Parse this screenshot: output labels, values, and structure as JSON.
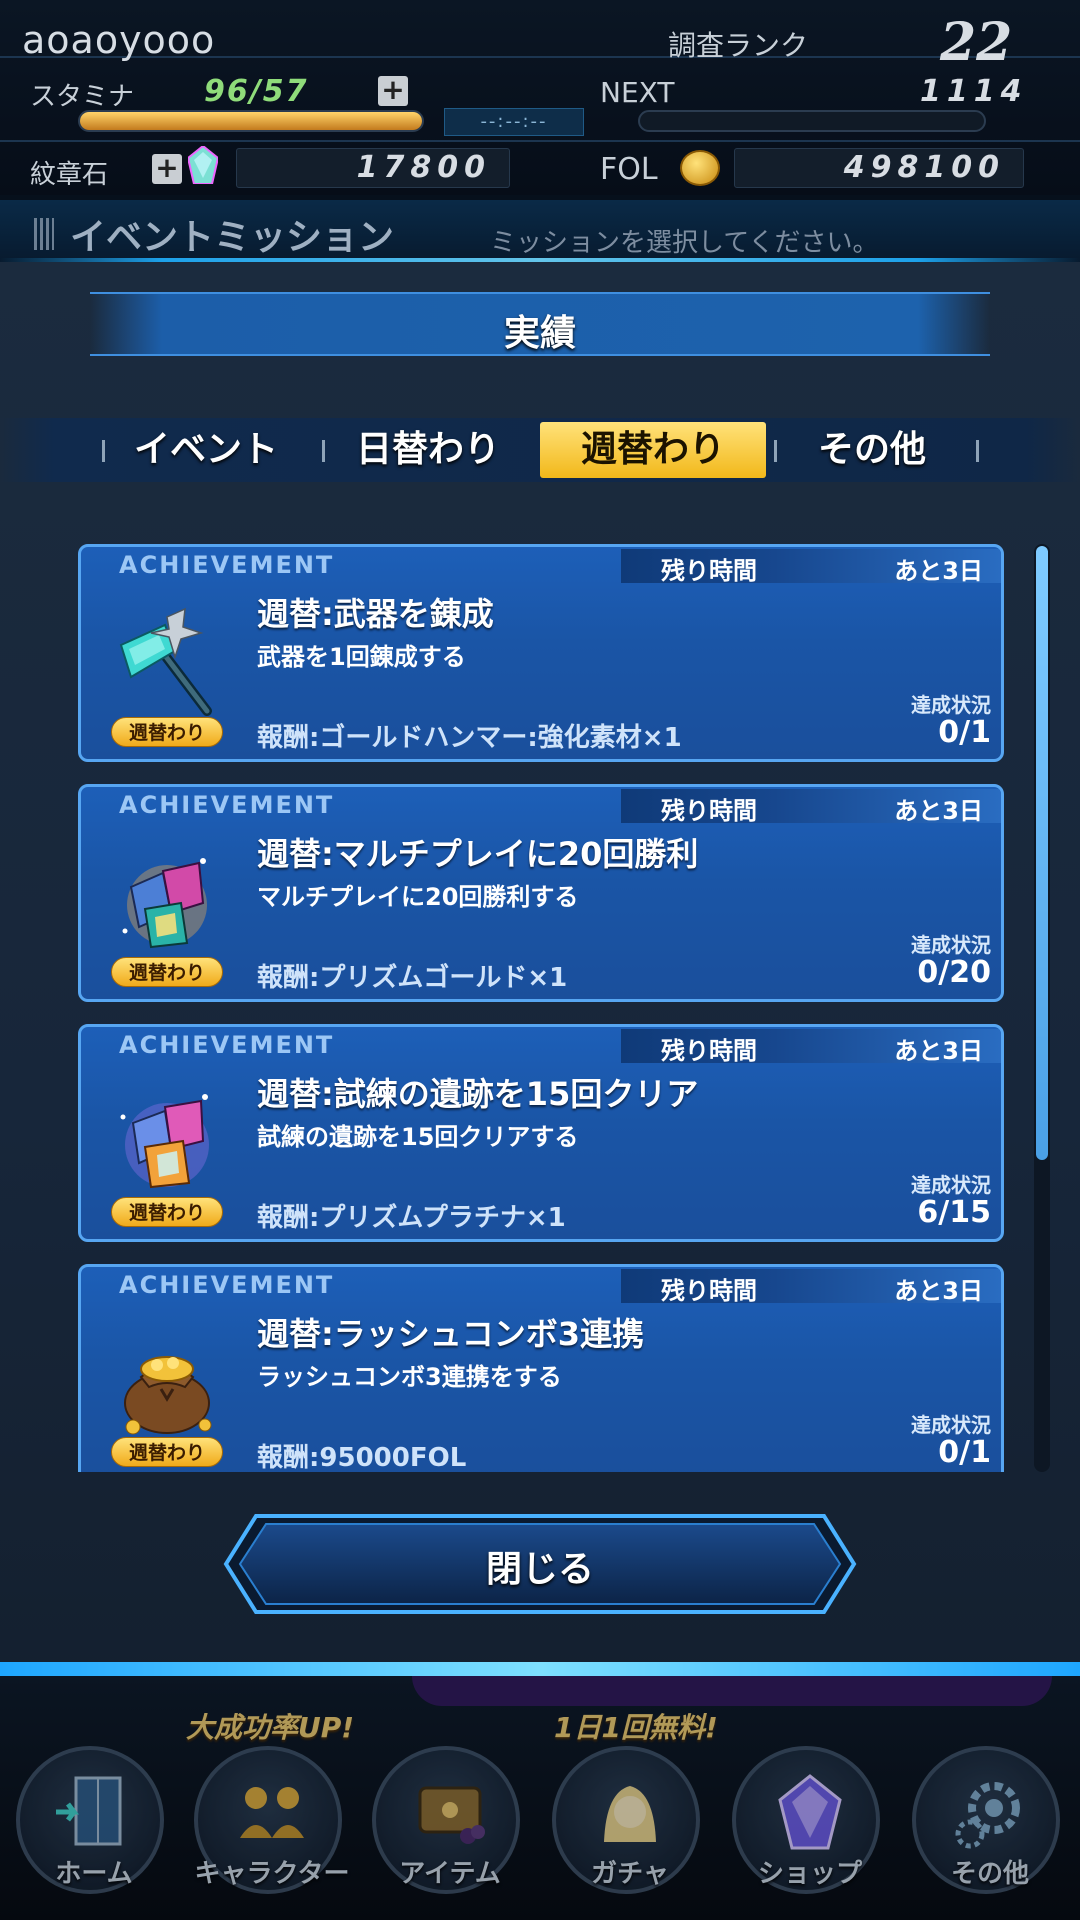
{
  "status": {
    "username": "aoaoyooo",
    "rank_label": "調査ランク",
    "rank_value": "22",
    "stamina_label": "スタミナ",
    "stamina_value": "96/57",
    "timer": "--:--:--",
    "next_label": "NEXT",
    "next_value": "1114",
    "crest_label": "紋章石",
    "crest_value": "17800",
    "fol_label": "FOL",
    "fol_value": "498100",
    "colors": {
      "stamina_text": "#8fdc7a",
      "stamina_bar": "#e9a63a"
    }
  },
  "band": {
    "title": "イベントミッション",
    "hint": "ミッションを選択してください。"
  },
  "modal": {
    "heading": "実績",
    "tabs": [
      {
        "label": "イベント",
        "active": false
      },
      {
        "label": "日替わり",
        "active": false
      },
      {
        "label": "週替わり",
        "active": true
      },
      {
        "label": "その他",
        "active": false
      }
    ],
    "cards": [
      {
        "tag": "ACHIEVEMENT",
        "time_label": "残り時間",
        "time_value": "あと3日",
        "title": "週替:武器を錬成",
        "desc": "武器を1回錬成する",
        "reward": "報酬:ゴールドハンマー:強化素材×1",
        "progress_label": "達成状況",
        "progress": "0/1",
        "badge": "週替わり",
        "icon": "hammer-icon"
      },
      {
        "tag": "ACHIEVEMENT",
        "time_label": "残り時間",
        "time_value": "あと3日",
        "title": "週替:マルチプレイに20回勝利",
        "desc": "マルチプレイに20回勝利する",
        "reward": "報酬:プリズムゴールド×1",
        "progress_label": "達成状況",
        "progress": "0/20",
        "badge": "週替わり",
        "icon": "prism-gold-icon"
      },
      {
        "tag": "ACHIEVEMENT",
        "time_label": "残り時間",
        "time_value": "あと3日",
        "title": "週替:試練の遺跡を15回クリア",
        "desc": "試練の遺跡を15回クリアする",
        "reward": "報酬:プリズムプラチナ×1",
        "progress_label": "達成状況",
        "progress": "6/15",
        "badge": "週替わり",
        "icon": "prism-platinum-icon"
      },
      {
        "tag": "ACHIEVEMENT",
        "time_label": "残り時間",
        "time_value": "あと3日",
        "title": "週替:ラッシュコンボ3連携",
        "desc": "ラッシュコンボ3連携をする",
        "reward": "報酬:95000FOL",
        "progress_label": "達成状況",
        "progress": "0/1",
        "badge": "週替わり",
        "icon": "coin-bag-icon"
      }
    ],
    "close_label": "閉じる"
  },
  "nav": {
    "promo_character": "大成功率UP!",
    "promo_gacha": "1日1回無料!",
    "items": [
      {
        "label": "ホーム",
        "icon": "home-icon"
      },
      {
        "label": "キャラクター",
        "icon": "character-icon"
      },
      {
        "label": "アイテム",
        "icon": "item-icon"
      },
      {
        "label": "ガチャ",
        "icon": "gacha-icon"
      },
      {
        "label": "ショップ",
        "icon": "shop-icon"
      },
      {
        "label": "その他",
        "icon": "gear-icon"
      }
    ]
  }
}
